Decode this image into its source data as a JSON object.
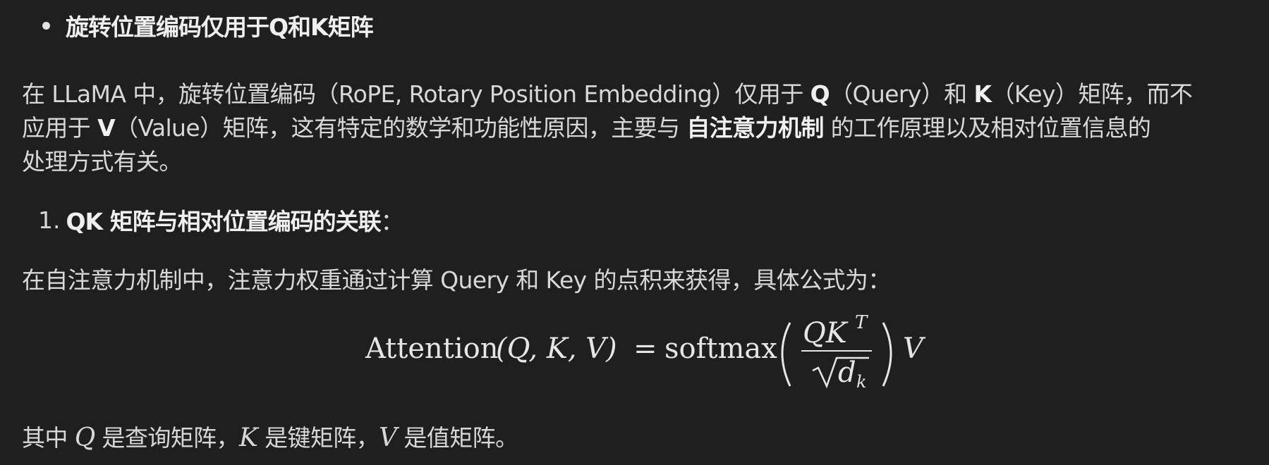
{
  "bullet": {
    "heading": "旋转位置编码仅用于Q和K矩阵"
  },
  "intro": {
    "line1_a": "在 LLaMA 中，旋转位置编码（RoPE, Rotary Position Embedding）仅用于 ",
    "line1_q": "Q",
    "line1_b": "（Query）和 ",
    "line1_k": "K",
    "line1_c": "（Key）矩阵，而不",
    "line2_a": "应用于 ",
    "line2_v": "V",
    "line2_b": "（Value）矩阵，这有特定的数学和功能性原因，主要与 ",
    "line2_bold": "自注意力机制",
    "line2_c": " 的工作原理以及相对位置信息的",
    "line3": "处理方式有关。"
  },
  "list": {
    "num": "1.",
    "heading": "QK 矩阵与相对位置编码的关联",
    "colon": "："
  },
  "para2": "在自注意力机制中，注意力权重通过计算 Query 和 Key 的点积来获得，具体公式为：",
  "formula": {
    "lhs": "Attention",
    "args": "(Q, K, V)",
    "eq": "=",
    "fn": "softmax",
    "num": "QK",
    "sup": "T",
    "den": "d",
    "den_sub": "k",
    "tail": "V"
  },
  "para3": {
    "a": "其中 ",
    "q": "Q",
    "b": " 是查询矩阵，",
    "k": "K",
    "c": " 是键矩阵，",
    "v": "V",
    "d": " 是值矩阵。"
  },
  "colors": {
    "background": "#1f1f1f",
    "text": "#d8d8d8",
    "bold_text": "#f0f0f0"
  }
}
